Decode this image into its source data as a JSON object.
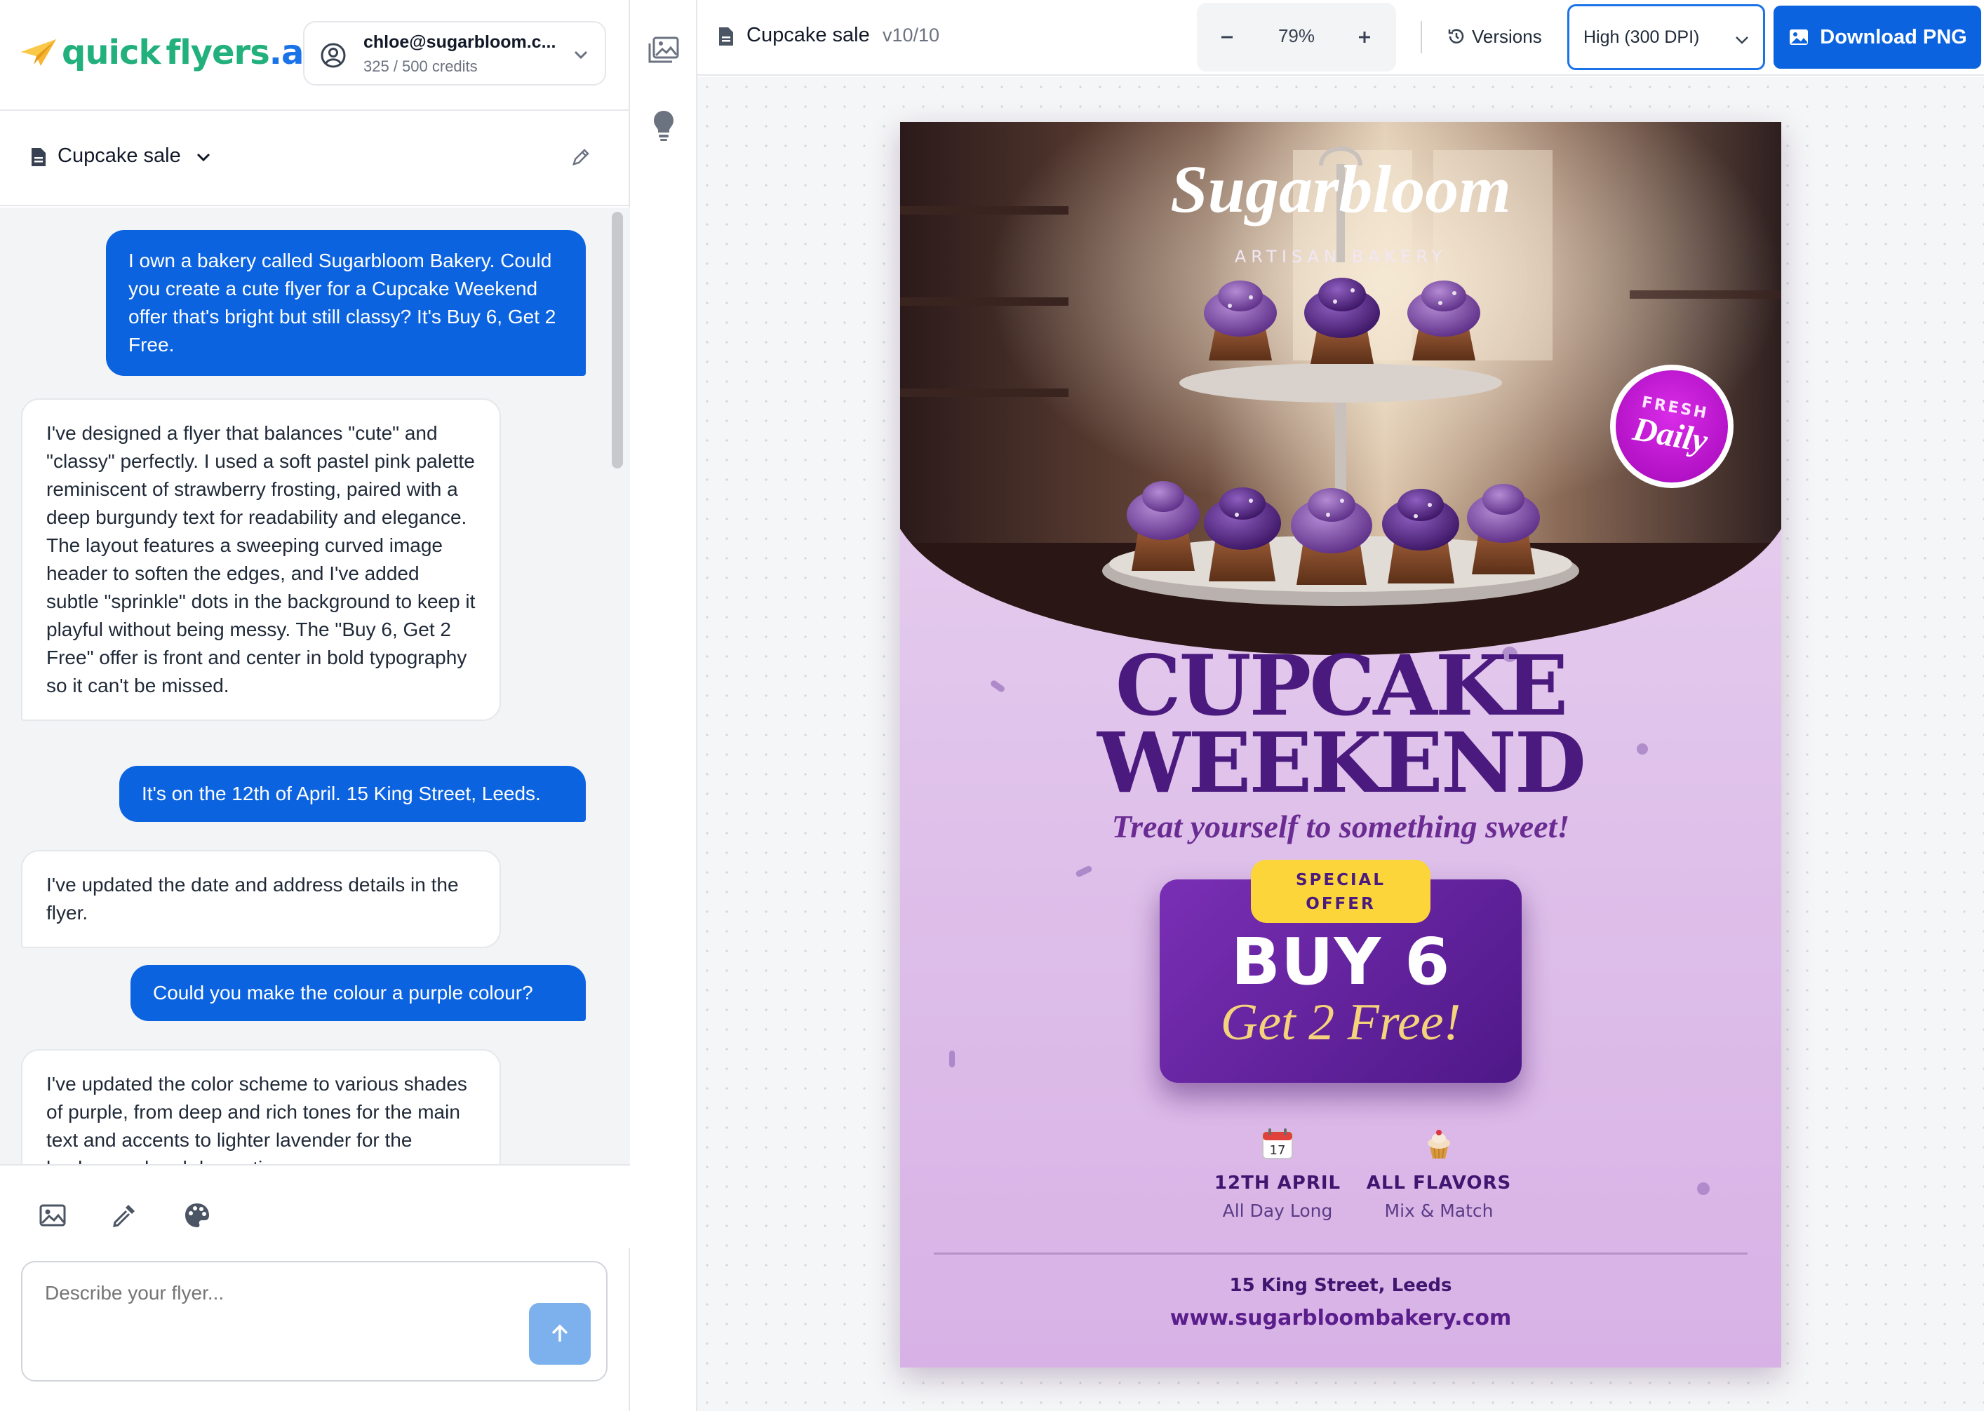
{
  "brand": {
    "part1": "quick",
    "part2": "flyers",
    "part3": ".ai"
  },
  "account": {
    "email": "chloe@sugarbloom.c...",
    "credits": "325 / 500 credits"
  },
  "project": {
    "name": "Cupcake sale"
  },
  "chat": {
    "messages": [
      {
        "role": "user",
        "text": "I own a bakery called Sugarbloom Bakery. Could you create a cute flyer for a Cupcake Weekend offer that's bright but still classy? It's Buy 6, Get 2 Free."
      },
      {
        "role": "assistant",
        "text": "I've designed a flyer that balances \"cute\" and \"classy\" perfectly. I used a soft pastel pink palette reminiscent of strawberry frosting, paired with a deep burgundy text for readability and elegance. The layout features a sweeping curved image header to soften the edges, and I've added subtle \"sprinkle\" dots in the background to keep it playful without being messy. The \"Buy 6, Get 2 Free\" offer is front and center in bold typography so it can't be missed."
      },
      {
        "role": "user",
        "text": "It's on the 12th of April. 15 King Street, Leeds."
      },
      {
        "role": "assistant",
        "text": "I've updated the date and address details in the flyer."
      },
      {
        "role": "user",
        "text": "Could you make the colour a purple colour?"
      },
      {
        "role": "assistant",
        "text": "I've updated the color scheme to various shades of purple, from deep and rich tones for the main text and accents to lighter lavender for the background and decorative"
      }
    ]
  },
  "composer": {
    "placeholder": "Describe your flyer..."
  },
  "toolbar": {
    "doc_title": "Cupcake sale",
    "version": "v10/10",
    "zoom": "79%",
    "versions_label": "Versions",
    "dpi_selected": "High (300 DPI)",
    "download_label": "Download PNG"
  },
  "flyer": {
    "logo_script": "Sugarbloom",
    "logo_sub": "ARTISAN BAKERY",
    "badge_top": "FRESH",
    "badge_bottom": "Daily",
    "title_line1": "CUPCAKE",
    "title_line2": "WEEKEND",
    "tagline": "Treat yourself to something sweet!",
    "offer_badge_line1": "SPECIAL",
    "offer_badge_line2": "OFFER",
    "offer_main": "BUY 6",
    "offer_sub": "Get 2 Free!",
    "feature1_icon_text": "17",
    "feature1_title": "12TH APRIL",
    "feature1_sub": "All Day Long",
    "feature2_title": "ALL FLAVORS",
    "feature2_sub": "Mix & Match",
    "address": "15 King Street, Leeds",
    "website": "www.sugarbloombakery.com"
  },
  "colors": {
    "primary_blue": "#0b63e0",
    "brand_green": "#22b07d",
    "flyer_purple": "#4a1a7e",
    "offer_yellow": "#fcd53a",
    "badge_magenta": "#c41ad6"
  },
  "icons": [
    "paper-plane-logo-icon",
    "user-circle-icon",
    "chevron-down-icon",
    "document-icon",
    "pencil-icon",
    "image-icon",
    "eyedropper-icon",
    "palette-icon",
    "arrow-up-icon",
    "gallery-icon",
    "lightbulb-icon",
    "minus-icon",
    "plus-icon",
    "history-icon",
    "download-image-icon",
    "calendar-icon",
    "cupcake-icon"
  ]
}
